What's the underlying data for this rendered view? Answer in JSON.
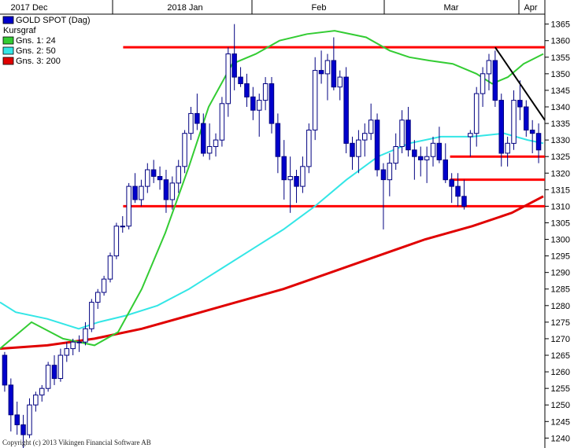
{
  "chart_data": {
    "type": "candlestick",
    "title": "GOLD SPOT (Dag)",
    "subtitle": "Kursgraf",
    "months": [
      "2017 Dec",
      "2018 Jan",
      "Feb",
      "Mar",
      "Apr"
    ],
    "y_ticks": [
      1240,
      1245,
      1250,
      1255,
      1260,
      1265,
      1270,
      1275,
      1280,
      1285,
      1290,
      1295,
      1300,
      1305,
      1310,
      1315,
      1320,
      1325,
      1330,
      1335,
      1340,
      1345,
      1350,
      1355,
      1360,
      1365
    ],
    "ylim": [
      1237,
      1368
    ],
    "colors": {
      "up_body": "#ffffff",
      "down_body": "#0000cc",
      "candle_outline": "#000080",
      "sma24": "#33cc33",
      "sma50": "#33e6e6",
      "sma200": "#e00000",
      "levels": "#ff0000",
      "trendline": "#000000"
    },
    "legend": [
      {
        "label": "GOLD SPOT (Dag)",
        "color": "#0000cc",
        "kind": "box"
      },
      {
        "label": "Kursgraf",
        "color": "",
        "kind": "none"
      },
      {
        "label": "Gns. 1: 24",
        "color": "#33cc33",
        "kind": "box"
      },
      {
        "label": "Gns. 2: 50",
        "color": "#33e6e6",
        "kind": "box"
      },
      {
        "label": "Gns. 3: 200",
        "color": "#e00000",
        "kind": "box"
      }
    ],
    "candles": [
      [
        1265,
        1266,
        1254,
        1256
      ],
      [
        1256,
        1258,
        1242,
        1247
      ],
      [
        1247,
        1251,
        1241,
        1244
      ],
      [
        1244,
        1247,
        1237,
        1241
      ],
      [
        1241,
        1252,
        1240,
        1250
      ],
      [
        1250,
        1254,
        1248,
        1253
      ],
      [
        1253,
        1256,
        1251,
        1255
      ],
      [
        1255,
        1263,
        1254,
        1262
      ],
      [
        1262,
        1265,
        1256,
        1258
      ],
      [
        1258,
        1267,
        1257,
        1265
      ],
      [
        1265,
        1269,
        1263,
        1267
      ],
      [
        1267,
        1270,
        1265,
        1269
      ],
      [
        1269,
        1271,
        1266,
        1269
      ],
      [
        1269,
        1275,
        1268,
        1273
      ],
      [
        1273,
        1282,
        1272,
        1281
      ],
      [
        1281,
        1285,
        1279,
        1284
      ],
      [
        1284,
        1289,
        1283,
        1288
      ],
      [
        1288,
        1296,
        1287,
        1295
      ],
      [
        1295,
        1305,
        1294,
        1304
      ],
      [
        1304,
        1307,
        1302,
        1304
      ],
      [
        1304,
        1317,
        1303,
        1316
      ],
      [
        1316,
        1320,
        1311,
        1312
      ],
      [
        1312,
        1318,
        1310,
        1316
      ],
      [
        1316,
        1323,
        1314,
        1321
      ],
      [
        1321,
        1324,
        1317,
        1319
      ],
      [
        1319,
        1322,
        1315,
        1318
      ],
      [
        1318,
        1321,
        1308,
        1312
      ],
      [
        1312,
        1319,
        1309,
        1317
      ],
      [
        1317,
        1324,
        1314,
        1322
      ],
      [
        1322,
        1333,
        1320,
        1332
      ],
      [
        1332,
        1340,
        1330,
        1338
      ],
      [
        1338,
        1344,
        1333,
        1335
      ],
      [
        1335,
        1338,
        1325,
        1326
      ],
      [
        1326,
        1335,
        1324,
        1328
      ],
      [
        1328,
        1332,
        1325,
        1330
      ],
      [
        1330,
        1343,
        1328,
        1341
      ],
      [
        1341,
        1358,
        1337,
        1356
      ],
      [
        1356,
        1365,
        1345,
        1349
      ],
      [
        1349,
        1352,
        1346,
        1347
      ],
      [
        1347,
        1350,
        1340,
        1343
      ],
      [
        1343,
        1346,
        1336,
        1339
      ],
      [
        1339,
        1344,
        1331,
        1342
      ],
      [
        1342,
        1349,
        1339,
        1347
      ],
      [
        1347,
        1349,
        1332,
        1335
      ],
      [
        1335,
        1338,
        1320,
        1325
      ],
      [
        1325,
        1330,
        1312,
        1318
      ],
      [
        1318,
        1325,
        1308,
        1319
      ],
      [
        1319,
        1321,
        1311,
        1316
      ],
      [
        1316,
        1325,
        1314,
        1322
      ],
      [
        1322,
        1335,
        1320,
        1333
      ],
      [
        1333,
        1355,
        1330,
        1351
      ],
      [
        1351,
        1357,
        1347,
        1350
      ],
      [
        1350,
        1356,
        1342,
        1354
      ],
      [
        1354,
        1361,
        1345,
        1346
      ],
      [
        1346,
        1351,
        1342,
        1349
      ],
      [
        1349,
        1352,
        1326,
        1329
      ],
      [
        1329,
        1331,
        1321,
        1325
      ],
      [
        1325,
        1333,
        1320,
        1330
      ],
      [
        1330,
        1335,
        1325,
        1332
      ],
      [
        1332,
        1341,
        1330,
        1336
      ],
      [
        1336,
        1338,
        1319,
        1321
      ],
      [
        1321,
        1323,
        1303,
        1318
      ],
      [
        1318,
        1326,
        1313,
        1323
      ],
      [
        1323,
        1332,
        1321,
        1328
      ],
      [
        1328,
        1339,
        1326,
        1336
      ],
      [
        1336,
        1340,
        1325,
        1327
      ],
      [
        1327,
        1330,
        1318,
        1325
      ],
      [
        1325,
        1328,
        1319,
        1324
      ],
      [
        1324,
        1328,
        1317,
        1325
      ],
      [
        1325,
        1331,
        1322,
        1329
      ],
      [
        1329,
        1334,
        1323,
        1324
      ],
      [
        1324,
        1329,
        1317,
        1318
      ],
      [
        1318,
        1320,
        1311,
        1316
      ],
      [
        1316,
        1320,
        1310,
        1313
      ],
      [
        1313,
        1318,
        1309,
        1310
      ],
      [
        1331,
        1333,
        1325,
        1332
      ],
      [
        1332,
        1346,
        1328,
        1344
      ],
      [
        1344,
        1352,
        1340,
        1350
      ],
      [
        1350,
        1356,
        1345,
        1354
      ],
      [
        1354,
        1357,
        1340,
        1342
      ],
      [
        1342,
        1344,
        1322,
        1326
      ],
      [
        1326,
        1331,
        1322,
        1329
      ],
      [
        1329,
        1345,
        1327,
        1342
      ],
      [
        1342,
        1348,
        1336,
        1340
      ],
      [
        1340,
        1342,
        1331,
        1333
      ],
      [
        1333,
        1336,
        1326,
        1332
      ],
      [
        1332,
        1335,
        1323,
        1327
      ]
    ],
    "sma24": [
      [
        0,
        1267
      ],
      [
        40,
        1275
      ],
      [
        80,
        1270
      ],
      [
        120,
        1268
      ],
      [
        150,
        1272
      ],
      [
        180,
        1285
      ],
      [
        210,
        1302
      ],
      [
        240,
        1322
      ],
      [
        265,
        1340
      ],
      [
        295,
        1353
      ],
      [
        325,
        1356
      ],
      [
        355,
        1360
      ],
      [
        390,
        1362
      ],
      [
        425,
        1363
      ],
      [
        465,
        1361
      ],
      [
        495,
        1357
      ],
      [
        520,
        1355
      ],
      [
        545,
        1354
      ],
      [
        575,
        1353
      ],
      [
        605,
        1350
      ],
      [
        625,
        1347
      ],
      [
        645,
        1349
      ],
      [
        665,
        1353
      ],
      [
        690,
        1356
      ]
    ],
    "sma50": [
      [
        0,
        1281
      ],
      [
        20,
        1278
      ],
      [
        60,
        1276
      ],
      [
        100,
        1273
      ],
      [
        125,
        1275
      ],
      [
        160,
        1277
      ],
      [
        200,
        1280
      ],
      [
        240,
        1285
      ],
      [
        280,
        1291
      ],
      [
        320,
        1297
      ],
      [
        360,
        1303
      ],
      [
        400,
        1310
      ],
      [
        440,
        1318
      ],
      [
        480,
        1325
      ],
      [
        520,
        1329
      ],
      [
        560,
        1331
      ],
      [
        600,
        1331
      ],
      [
        640,
        1332
      ],
      [
        670,
        1330
      ],
      [
        690,
        1329
      ]
    ],
    "sma200": [
      [
        0,
        1267
      ],
      [
        60,
        1268
      ],
      [
        120,
        1270
      ],
      [
        180,
        1273
      ],
      [
        240,
        1277
      ],
      [
        300,
        1281
      ],
      [
        360,
        1285
      ],
      [
        420,
        1290
      ],
      [
        480,
        1295
      ],
      [
        540,
        1300
      ],
      [
        600,
        1304
      ],
      [
        650,
        1308
      ],
      [
        690,
        1313
      ]
    ],
    "levels": [
      {
        "value": 1358,
        "x_start_frac": 0.226,
        "x_end_frac": 1.0
      },
      {
        "value": 1310,
        "x_start_frac": 0.226,
        "x_end_frac": 1.0
      },
      {
        "value": 1325,
        "x_start_frac": 0.826,
        "x_end_frac": 1.0
      },
      {
        "value": 1318,
        "x_start_frac": 0.826,
        "x_end_frac": 1.0
      }
    ],
    "trendline": {
      "from": {
        "index": 79,
        "value": 1358
      },
      "to": {
        "index": 87,
        "value": 1336
      }
    },
    "copyright": "Copyright (c) 2013 Vikingen Financial Software AB"
  }
}
